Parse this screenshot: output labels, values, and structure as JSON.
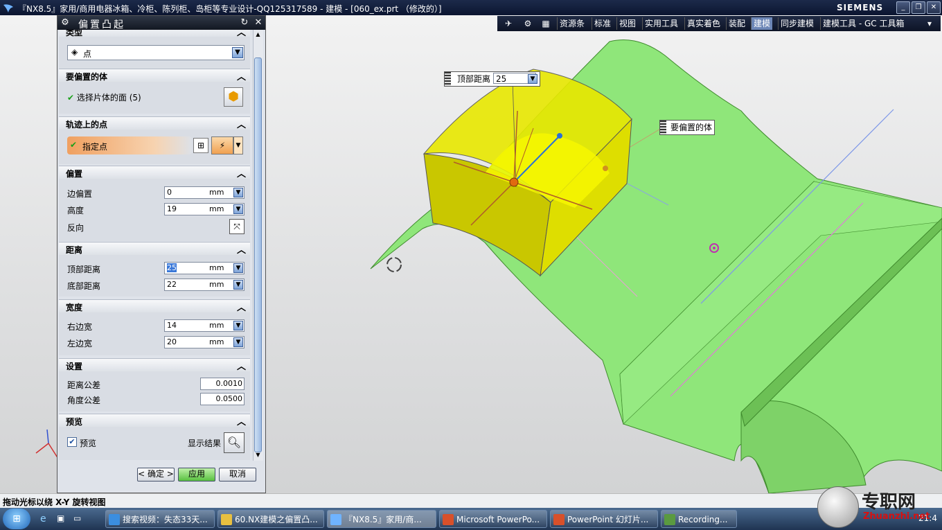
{
  "window": {
    "title": "『NX8.5』家用/商用电器冰箱、冷柜、陈列柜、岛柜等专业设计-QQ125317589 - 建模 - [060_ex.prt （修改的）]",
    "brand": "SIEMENS"
  },
  "toolbar": {
    "tabs": [
      "资源条",
      "标准",
      "视图",
      "实用工具",
      "真实着色",
      "装配",
      "建模",
      "同步建模",
      "建模工具 - GC 工具箱"
    ],
    "active_tab": "建模"
  },
  "dialog": {
    "title": "偏置凸起",
    "type_section": {
      "label": "类型",
      "selected": "点"
    },
    "body_section": {
      "label": "要偏置的体",
      "select_label": "选择片体的面 (5)"
    },
    "point_section": {
      "label": "轨迹上的点",
      "specify_label": "指定点"
    },
    "offset_section": {
      "label": "偏置",
      "edge_offset": {
        "label": "边偏置",
        "value": "0",
        "unit": "mm"
      },
      "height": {
        "label": "高度",
        "value": "19",
        "unit": "mm"
      },
      "reverse_label": "反向"
    },
    "distance_section": {
      "label": "距离",
      "top": {
        "label": "顶部距离",
        "value": "25",
        "unit": "mm"
      },
      "bottom": {
        "label": "底部距离",
        "value": "22",
        "unit": "mm"
      }
    },
    "width_section": {
      "label": "宽度",
      "right": {
        "label": "右边宽",
        "value": "14",
        "unit": "mm"
      },
      "left": {
        "label": "左边宽",
        "value": "20",
        "unit": "mm"
      }
    },
    "settings_section": {
      "label": "设置",
      "dist_tol": {
        "label": "距离公差",
        "value": "0.0010"
      },
      "angle_tol": {
        "label": "角度公差",
        "value": "0.0500"
      }
    },
    "preview_section": {
      "label": "预览",
      "preview_label": "预览",
      "show_result_label": "显示结果"
    },
    "buttons": {
      "ok": "< 确定 >",
      "apply": "应用",
      "cancel": "取消"
    }
  },
  "viewport": {
    "top_distance_tag": {
      "label": "顶部距离",
      "value": "25"
    },
    "body_tag": "要偏置的体"
  },
  "status": {
    "text": "拖动光标以绕 X-Y 旋转视图"
  },
  "taskbar": {
    "items": [
      "搜索视频：失态33天...",
      "60.NX建模之偏置凸...",
      "『NX8.5』家用/商...",
      "Microsoft PowerPo...",
      "PowerPoint 幻灯片...",
      "Recording..."
    ],
    "clock": "21:4"
  },
  "watermark": {
    "text": "专职网",
    "url": "Zhuanzhi.net"
  },
  "colors": {
    "surface": "#8fe67a",
    "offset_body": "#e6e600",
    "title_bg": "#0b1530"
  }
}
